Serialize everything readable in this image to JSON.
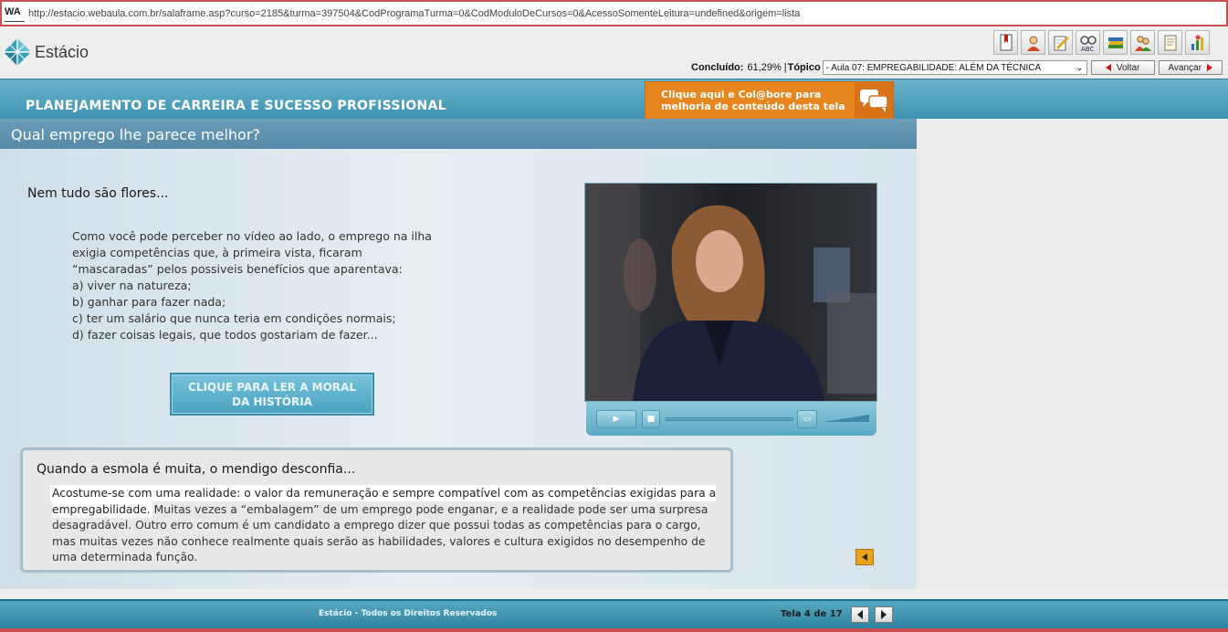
{
  "browser": {
    "address_icon": "WA",
    "url": "http://estacio.webaula.com.br/salaframe.asp?curso=2185&turma=397504&CodProgramaTurma=0&CodModuloDeCursos=0&AcessoSomenteLeitura=undefined&origem=lista"
  },
  "header": {
    "logo_text": "Estácio",
    "toolbar_icons": [
      "bookmark-icon",
      "user-support-icon",
      "notepad-icon",
      "spellcheck-icon",
      "books-icon",
      "users-icon",
      "document-icon",
      "chart-icon"
    ],
    "progress_label": "Concluído:",
    "progress_value": "61,29%",
    "topic_label": "Tópico",
    "topic_selected": "- Aula 07: EMPREGABILIDADE: ALÉM DA TÉCNICA",
    "back_label": "Voltar",
    "next_label": "Avançar"
  },
  "banner": {
    "course_title": "PLANEJAMENTO DE CARREIRA E SUCESSO PROFISSIONAL",
    "collab_line1": "Clique aqui e Col@bore para",
    "collab_line2": "melhoria de conteúdo desta tela"
  },
  "page": {
    "heading": "Qual emprego lhe parece melhor?",
    "subheading": "Nem tudo são flores...",
    "paragraph_lines": [
      "Como você pode perceber no vídeo ao lado, o emprego na ilha",
      "exigia competências que, à primeira vista, ficaram",
      "“mascaradas” pelos possiveis benefícios que aparentava:",
      "a) viver na natureza;",
      "b) ganhar para fazer nada;",
      "c) ter um salário que nunca teria em condições normais;",
      "d) fazer coisas legais, que todos gostariam de fazer..."
    ],
    "moral_button_line1": "CLIQUE PARA LER A MORAL",
    "moral_button_line2": "DA HISTÓRIA",
    "moral_title": "Quando a esmola é muita, o mendigo desconfia...",
    "moral_highlight": "Acostume-se com uma realidade: o valor da remuneração e sempre compatível com as competências exigidas para a empregabilidade.",
    "moral_rest": " Muitas vezes a “embalagem” de um emprego pode enganar, e a realidade pode ser uma surpresa desagradável. Outro erro comum é um candidato a emprego dizer que possui todas as competências para o cargo, mas muitas vezes não conhece realmente quais serão as habilidades, valores e cultura exigidos no desempenho de uma determinada função."
  },
  "footer": {
    "copyright": "Estácio - Todos os Direitos Reservados",
    "page_indicator": "Tela 4 de 17"
  },
  "colors": {
    "accent_blue": "#4a9fbd",
    "collab_orange": "#e7861e",
    "address_border": "#c8504f"
  }
}
